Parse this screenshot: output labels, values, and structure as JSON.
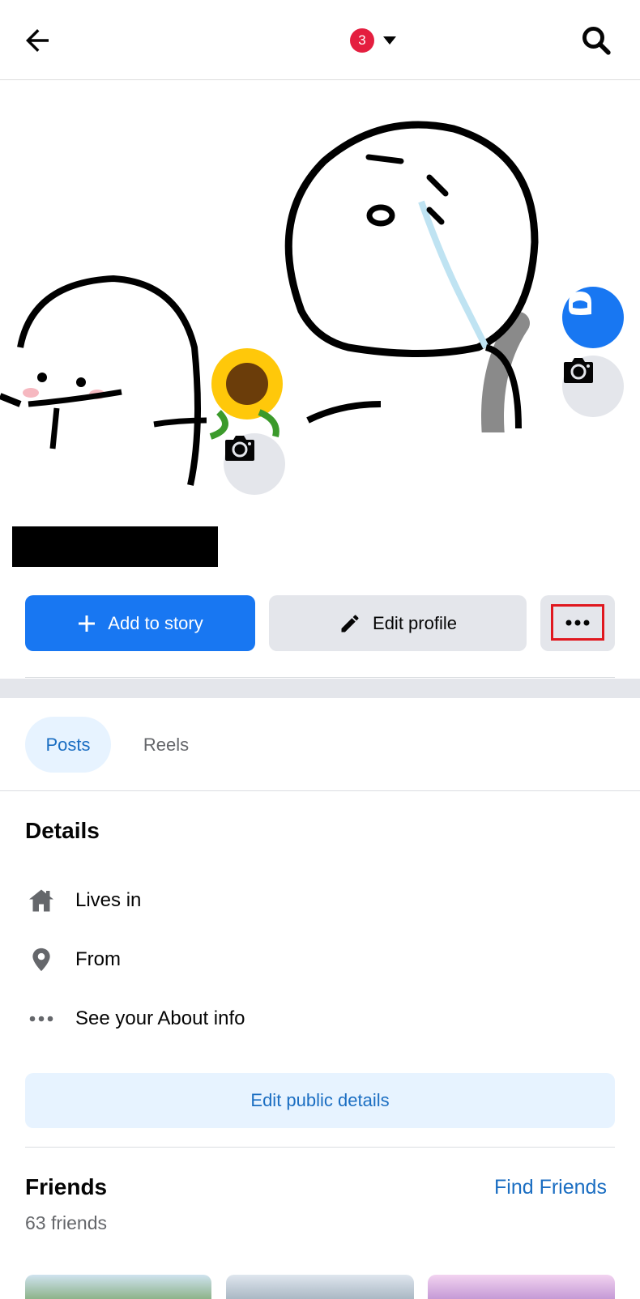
{
  "topbar": {
    "back_icon": "arrow-left-icon",
    "notification_count": "3",
    "dropdown_icon": "caret-down-icon",
    "search_icon": "search-icon"
  },
  "cover": {
    "avatar_icon": "avatar-icon",
    "cover_camera_icon": "camera-icon",
    "profile_camera_icon": "camera-icon"
  },
  "actions": {
    "add_story_label": "Add to story",
    "edit_profile_label": "Edit profile",
    "more_icon": "more-dots-icon"
  },
  "tabs": [
    {
      "label": "Posts",
      "active": true
    },
    {
      "label": "Reels",
      "active": false
    }
  ],
  "details": {
    "title": "Details",
    "items": [
      {
        "icon": "home-icon",
        "label": "Lives in"
      },
      {
        "icon": "location-pin-icon",
        "label": "From"
      },
      {
        "icon": "more-dots-icon",
        "label": "See your About info"
      }
    ],
    "edit_button": "Edit public details"
  },
  "friends": {
    "title": "Friends",
    "find_link": "Find Friends",
    "count_text": "63 friends"
  },
  "colors": {
    "brand_blue": "#1877f2",
    "link_blue": "#1b6ec2",
    "badge_red": "#e41e3f",
    "highlight_red": "#e0181f",
    "button_gray": "#e4e6eb",
    "tab_active_bg": "#e7f3ff"
  }
}
